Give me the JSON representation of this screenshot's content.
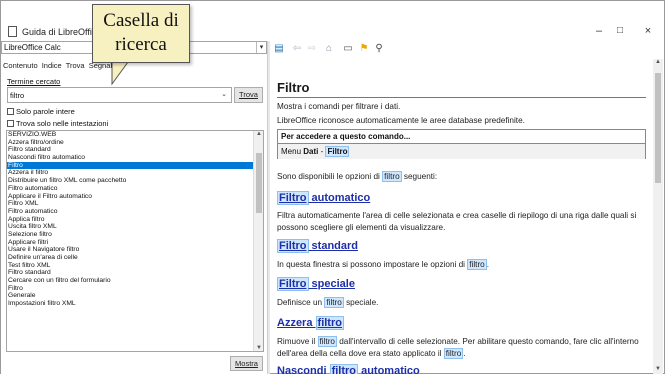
{
  "window": {
    "title": "Guida di LibreOffice -",
    "minimize": "–",
    "maximize": "□",
    "close": "×"
  },
  "left_pane": {
    "module": "LibreOffice Calc",
    "tabs": [
      "Contenuto",
      "Indice",
      "Trova",
      "Segnal"
    ],
    "search_label": "Termine cercato",
    "search_value": "filtro",
    "search_button": "Trova",
    "checkbox_whole_words": "Solo parole intere",
    "checkbox_headings": "Trova solo nelle intestazioni",
    "results": [
      "SERVIZIO.WEB",
      "Azzera filtro/ordine",
      "Filtro standard",
      "Nascondi filtro automatico",
      "Filtro",
      "Azzera il filtro",
      "Distribuire un filtro XML come pacchetto",
      "Filtro automatico",
      "Applicare il Filtro automatico",
      "Filtro XML",
      "Filtro automatico",
      "Applica filtro",
      "Uscita filtro XML",
      "Selezione filtro",
      "Applicare filtri",
      "Usare il Navigatore filtro",
      "Definire un'area di celle",
      "Test filtro XML",
      "Filtro standard",
      "Cercare con un filtro del formulario",
      "Filtro",
      "Generale",
      "Impostazioni filtro XML"
    ],
    "selected_index": 4,
    "show_button": "Mostra"
  },
  "toolbar": {
    "icons": [
      "sidebar-toggle-icon",
      "back-icon",
      "forward-icon",
      "home-icon",
      "print-icon",
      "bookmark-icon",
      "search-icon"
    ]
  },
  "content": {
    "title": "Filtro",
    "intro1": "Mostra i comandi per filtrare i dati.",
    "intro2": "LibreOffice riconosce automaticamente le aree database predefinite.",
    "access_header": "Per accedere a questo comando...",
    "access_menu_prefix": "Menu ",
    "access_menu_dati": "Dati",
    "access_menu_sep": " - ",
    "access_menu_filtro": "Filtro",
    "options_pre": "Sono disponibili le opzioni di ",
    "options_hl": "filtro",
    "options_post": " seguenti:",
    "s1_title_a": "Filtro",
    "s1_title_b": " automatico",
    "s1_line1": "Filtra automaticamente l'area di celle selezionata e crea caselle di riepilogo di una riga dalle quali si",
    "s1_line2": "possono scegliere gli elementi da visualizzare.",
    "s2_title_a": "Filtro",
    "s2_title_b": " standard",
    "s2_pre": "In questa finestra si possono impostare le opzioni di ",
    "s2_hl": "filtro",
    "s2_post": ".",
    "s3_title_a": "Filtro",
    "s3_title_b": " speciale",
    "s3_pre": "Definisce un ",
    "s3_hl": "filtro",
    "s3_post": " speciale.",
    "s4_title_a": "Azzera ",
    "s4_title_b": "filtro",
    "s4_pre": "Rimuove il ",
    "s4_hl": "filtro",
    "s4_post": " dall'intervallo di celle selezionate. Per abilitare questo comando, fare clic all'interno",
    "s4_line2_pre": "dell'area della cella dove era stato applicato il ",
    "s4_line2_hl": "filtro",
    "s4_line2_post": ".",
    "s5_title_a": "Nascondi ",
    "s5_title_b": "filtro",
    "s5_title_c": " automatico"
  },
  "callout": {
    "line1": "Casella di",
    "line2": "ricerca",
    "fill": "#f7f0c0"
  },
  "colors": {
    "selection": "#0078d7",
    "heading_link": "#1d2fa8",
    "highlight": "#cfe6ff"
  }
}
